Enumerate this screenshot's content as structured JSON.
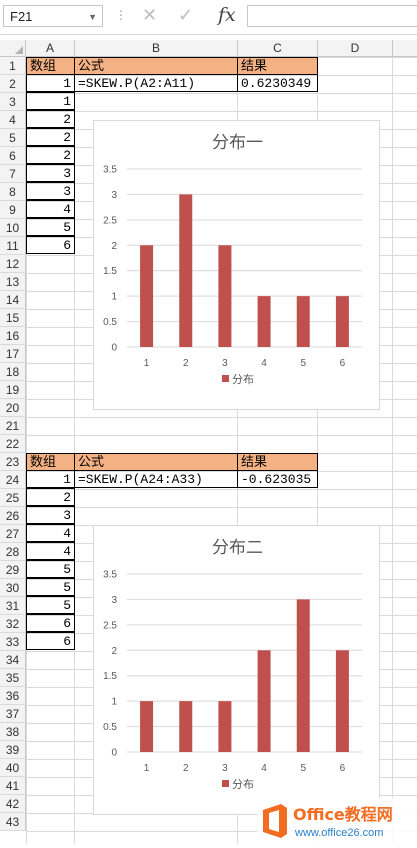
{
  "formula_bar": {
    "name_box": "F21",
    "fx": "fx",
    "content": ""
  },
  "columns": [
    "A",
    "B",
    "C",
    "D"
  ],
  "rows": [
    "1",
    "2",
    "3",
    "4",
    "5",
    "6",
    "7",
    "8",
    "9",
    "10",
    "11",
    "12",
    "13",
    "14",
    "15",
    "16",
    "17",
    "18",
    "19",
    "20",
    "21",
    "22",
    "23",
    "24",
    "25",
    "26",
    "27",
    "28",
    "29",
    "30",
    "31",
    "32",
    "33",
    "34",
    "35",
    "36",
    "37",
    "38",
    "39",
    "40",
    "41",
    "42",
    "43"
  ],
  "table1": {
    "header": [
      "数组",
      "公式",
      "结果"
    ],
    "formula": "=SKEW.P(A2:A11)",
    "result": "0.6230349",
    "values": [
      "1",
      "1",
      "2",
      "2",
      "2",
      "3",
      "3",
      "4",
      "5",
      "6"
    ]
  },
  "table2": {
    "header": [
      "数组",
      "公式",
      "结果"
    ],
    "formula": "=SKEW.P(A24:A33)",
    "result": "-0.623035",
    "values": [
      "1",
      "2",
      "3",
      "4",
      "4",
      "5",
      "5",
      "5",
      "6",
      "6"
    ]
  },
  "chart_data": [
    {
      "type": "bar",
      "title": "分布一",
      "categories": [
        "1",
        "2",
        "3",
        "4",
        "5",
        "6"
      ],
      "series": [
        {
          "name": "分布",
          "values": [
            2,
            3,
            2,
            1,
            1,
            1
          ]
        }
      ],
      "ylim": [
        0,
        3.5
      ],
      "yticks": [
        "0",
        "0.5",
        "1",
        "1.5",
        "2",
        "2.5",
        "3",
        "3.5"
      ],
      "legend_position": "bottom",
      "color": "#c0504d"
    },
    {
      "type": "bar",
      "title": "分布二",
      "categories": [
        "1",
        "2",
        "3",
        "4",
        "5",
        "6"
      ],
      "series": [
        {
          "name": "分布",
          "values": [
            1,
            1,
            1,
            2,
            3,
            2
          ]
        }
      ],
      "ylim": [
        0,
        3.5
      ],
      "yticks": [
        "0",
        "0.5",
        "1",
        "1.5",
        "2",
        "2.5",
        "3",
        "3.5"
      ],
      "legend_position": "bottom",
      "color": "#c0504d"
    }
  ],
  "watermark": {
    "brand": "Office教程网",
    "url": "www.office26.com",
    "accent": "#f26c21"
  }
}
